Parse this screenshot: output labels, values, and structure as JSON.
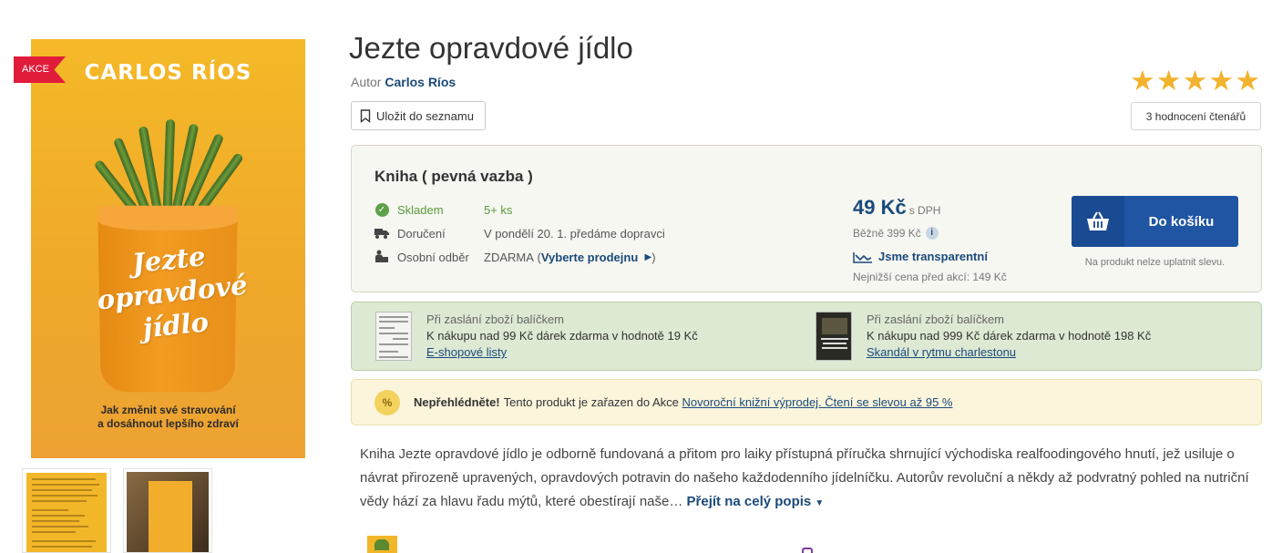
{
  "cover": {
    "badge": "AKCE",
    "author": "CARLOS RÍOS",
    "title_lines": [
      "Jezte",
      "opravdové",
      "jídlo"
    ],
    "subtitle_lines": [
      "Jak změnit své stravování",
      "a dosáhnout lepšího zdraví"
    ]
  },
  "product": {
    "title": "Jezte opravdové jídlo",
    "author_prefix": "Autor",
    "author": "Carlos Ríos",
    "save_label": "Uložit do seznamu",
    "rating_stars": 5,
    "rating_label": "3 hodnocení čtenářů"
  },
  "buy": {
    "format": "Kniha ( pevná vazba )",
    "stock_label": "Skladem",
    "stock_value": "5+ ks",
    "delivery_label": "Doručení",
    "delivery_value": "V pondělí 20. 1. předáme dopravci",
    "pickup_label": "Osobní odběr",
    "pickup_value": "ZDARMA",
    "pickup_link": "Vyberte prodejnu",
    "price": "49 Kč",
    "price_suffix": "s DPH",
    "normal_price": "Běžně 399 Kč",
    "info_icon": "i",
    "transparent_label": "Jsme transparentní",
    "lowest_price": "Nejnižší cena před akcí: 149 Kč",
    "cart_label": "Do košíku",
    "no_discount": "Na produkt nelze uplatnit slevu."
  },
  "gifts": [
    {
      "title": "Při zaslání zboží balíčkem",
      "text": "K nákupu nad 99 Kč dárek zdarma v hodnotě 19 Kč",
      "link": "E-shopové listy"
    },
    {
      "title": "Při zaslání zboží balíčkem",
      "text": "K nákupu nad 999 Kč dárek zdarma v hodnotě 198 Kč",
      "link": "Skandál v rytmu charlestonu"
    }
  ],
  "promo": {
    "icon_text": "%",
    "bold": "Nepřehlédněte!",
    "text": "Tento produkt je zařazen do Akce",
    "link": "Novoroční knižní výprodej. Čtení se slevou až 95 %"
  },
  "description": {
    "text": "Kniha Jezte opravdové jídlo je odborně fundovaná a přitom pro laiky přístupná příručka shrnující východiska realfoodingového hnutí, jež usiluje o návrat přirozeně upravených, opravdových potravin do našeho každodenního jídelníčku. Autorův revoluční a někdy až podvratný pohled na nutriční vědy hází za hlavu řadu mýtů, které obestírají naše…",
    "more_link": "Přejít na celý popis"
  },
  "colors": {
    "accent_blue": "#1a4a7a",
    "cart_blue": "#1f55a3",
    "star_gold": "#f2b32e",
    "badge_red": "#e11c3a",
    "stock_green": "#5a9a3b"
  }
}
